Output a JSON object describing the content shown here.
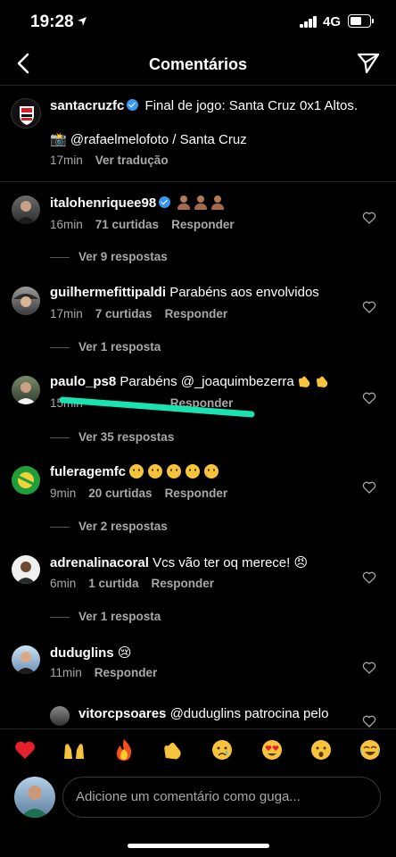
{
  "status": {
    "time": "19:28",
    "network": "4G",
    "battery_level": 0.65
  },
  "nav": {
    "title": "Comentários"
  },
  "caption": {
    "username": "santacruzfc",
    "verified": true,
    "text": "Final de jogo: Santa Cruz 0x1 Altos.",
    "credit": "📸 @rafaelmelofoto / Santa Cruz",
    "time": "17min",
    "translate": "Ver tradução"
  },
  "comments": [
    {
      "username": "italohenriquee98",
      "verified": true,
      "text": "",
      "emoji": "person-x3",
      "time": "16min",
      "likes": "71 curtidas",
      "reply": "Responder",
      "replies": "Ver 9 respostas"
    },
    {
      "username": "guilhermefittipaldi",
      "text": "Parabéns aos envolvidos",
      "time": "17min",
      "likes": "7 curtidas",
      "reply": "Responder",
      "replies": "Ver 1 resposta"
    },
    {
      "username": "paulo_ps8",
      "text": "Parabéns @_joaquimbezerra",
      "emoji": "clap-x2",
      "time": "15min",
      "likes": "",
      "reply": "Responder",
      "replies": "Ver 35 respostas"
    },
    {
      "username": "fuleragemfc",
      "text": "",
      "emoji": "face-x5",
      "time": "9min",
      "likes": "20 curtidas",
      "reply": "Responder",
      "replies": "Ver 2 respostas"
    },
    {
      "username": "adrenalinacoral",
      "text": "Vcs vão ter oq merece! 😠",
      "time": "6min",
      "likes": "1 curtida",
      "reply": "Responder",
      "replies": "Ver 1 resposta"
    },
    {
      "username": "duduglins",
      "text": "😢",
      "time": "11min",
      "likes": "",
      "reply": "Responder",
      "replies": ""
    }
  ],
  "partial_reply": {
    "username": "vitorcpsoares",
    "text": "@duduglins patrocina pelo"
  },
  "quick_emojis": [
    "❤️",
    "🙌",
    "🔥",
    "👏",
    "😢",
    "😍",
    "😮",
    "😂"
  ],
  "composer": {
    "placeholder": "Adicione um comentário como guga..."
  },
  "colors": {
    "background": "#000000",
    "secondary_text": "#a8a8a8",
    "verified": "#3897f0",
    "highlight": "#19e3b1"
  }
}
